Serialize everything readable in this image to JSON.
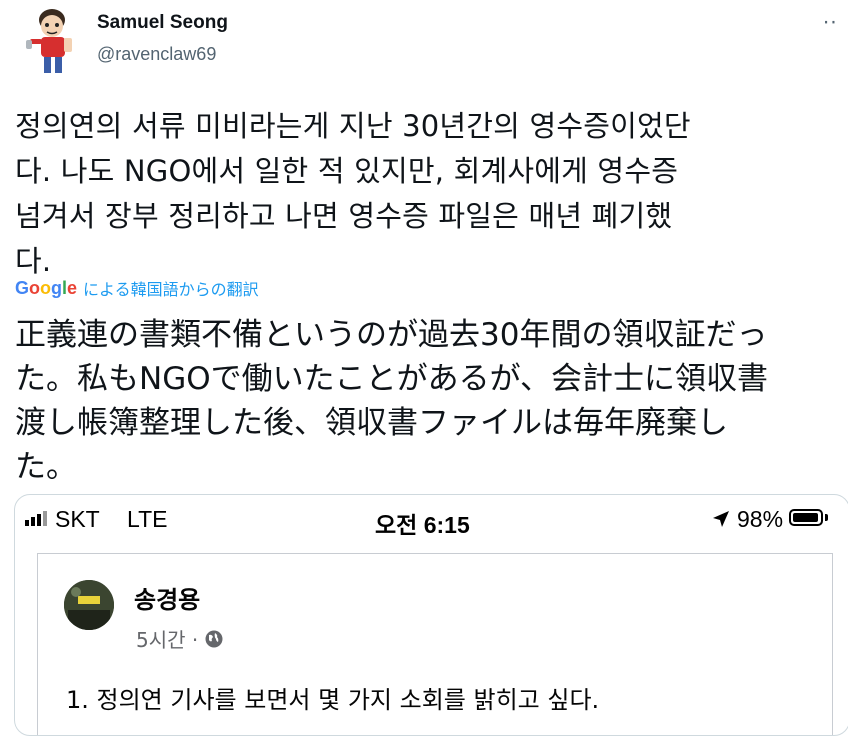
{
  "tweet": {
    "author": {
      "display_name": "Samuel Seong",
      "handle": "@ravenclaw69",
      "avatar_icon": "cartoon-avatar"
    },
    "more_icon": "more-dots-icon",
    "text": "정의연의 서류 미비라는게 지난 30년간의 영수증이었단\n다. 나도 NGO에서 일한 적 있지만, 회계사에게 영수증\n넘겨서 장부 정리하고 나면 영수증 파일은 매년 폐기했\n다.",
    "translation": {
      "logo_text": "Google",
      "label": "による韓国語からの翻訳",
      "text": "正義連の書類不備というのが過去30年間の領収証だっ\nた。私もNGOで働いたことがあるが、会計士に領収書\n渡し帳簿整理した後、領収書ファイルは毎年廃棄し\nた。"
    }
  },
  "screenshot": {
    "status_bar": {
      "carrier": "SKT",
      "network": "LTE",
      "time": "오전 6:15",
      "battery": "98%",
      "battery_level": 0.98,
      "signal_icon": "signal-bars-icon",
      "location_icon": "location-arrow-icon",
      "battery_icon": "battery-icon"
    },
    "post": {
      "author": "송경용",
      "time": "5시간 ·",
      "privacy_icon": "globe-icon",
      "body": "1. 정의연 기사를 보면서 몇 가지 소회를 밝히고 싶다."
    }
  },
  "colors": {
    "text": "#0f1419",
    "secondary": "#536471",
    "link": "#1d9bf0",
    "border": "#cfd9de",
    "fb_text": "#050505",
    "fb_secondary": "#65676b"
  }
}
